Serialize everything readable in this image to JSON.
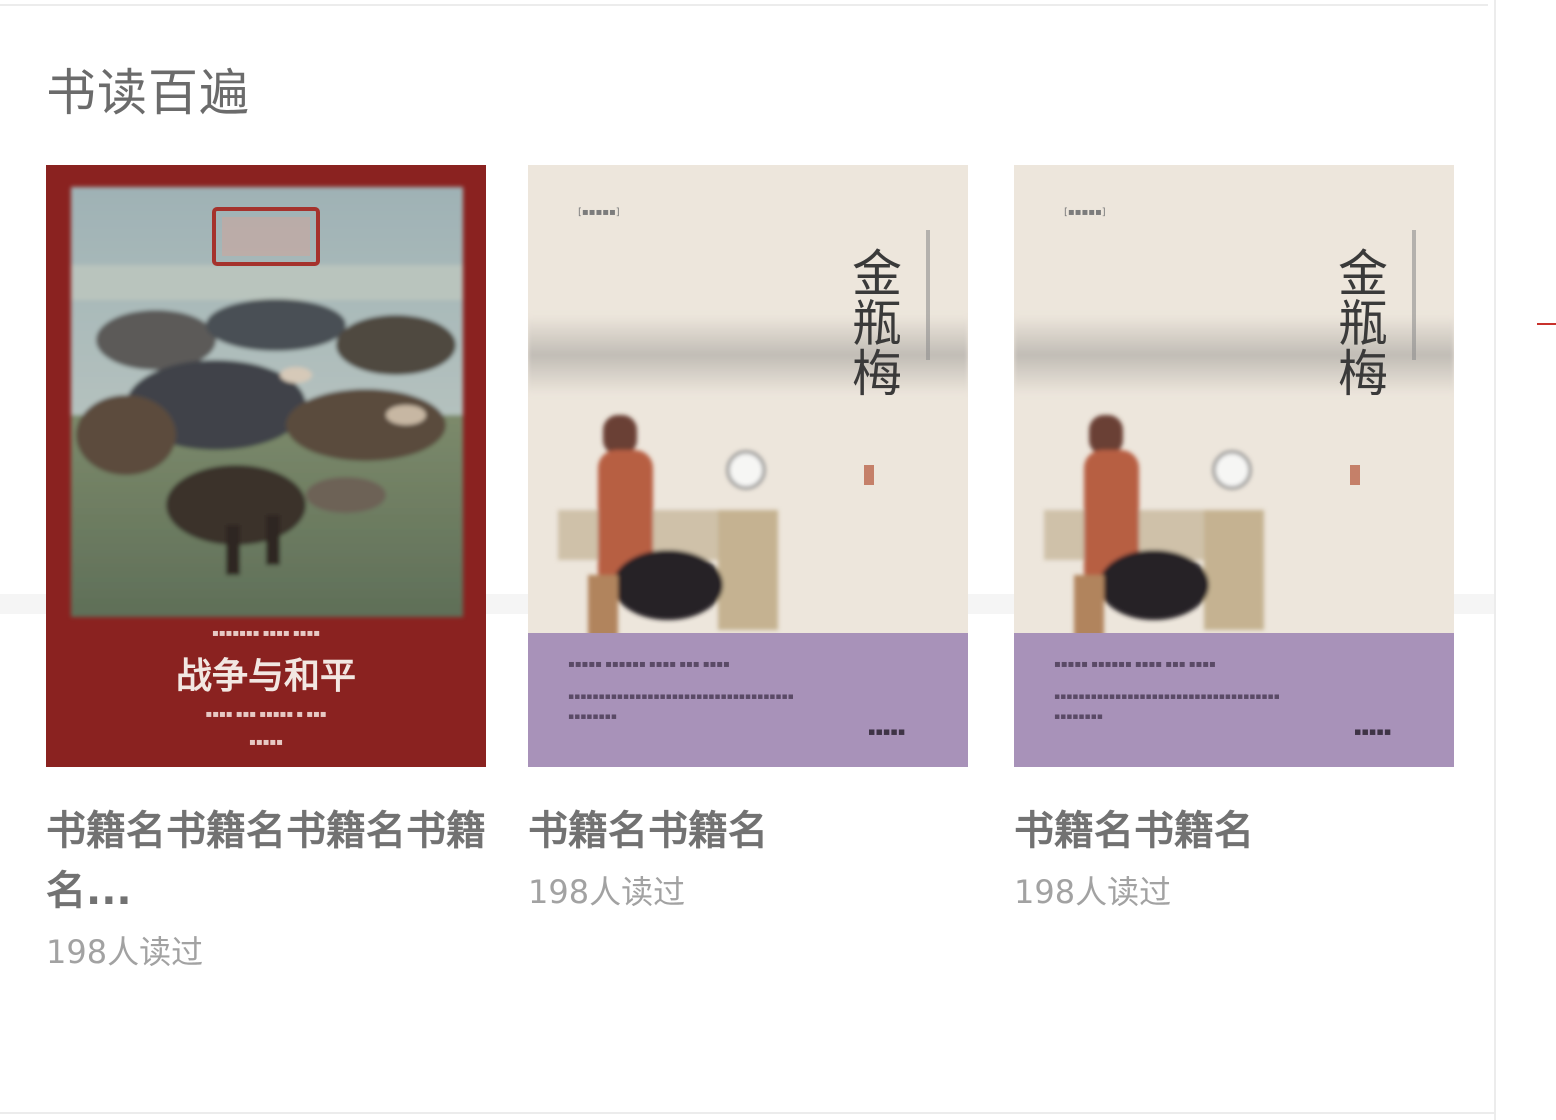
{
  "section": {
    "title": "书读百遍"
  },
  "books": [
    {
      "title": "书籍名书籍名书籍名书籍名...",
      "readers": "198人读过",
      "cover": {
        "title_text": "战争与和平",
        "palette": {
          "frame": "#8a2220",
          "sky": "#9fb2b5",
          "field": "#6f7d61",
          "ink": "#3b3530"
        }
      }
    },
    {
      "title": "书籍名书籍名",
      "readers": "198人读过",
      "cover": {
        "title_text": "金瓶梅",
        "palette": {
          "paper": "#ede6dc",
          "band": "#a892b9",
          "ink": "#3a3a3a",
          "robe": "#b75e43"
        }
      }
    },
    {
      "title": "书籍名书籍名",
      "readers": "198人读过",
      "cover": {
        "title_text": "金瓶梅",
        "palette": {
          "paper": "#ede6dc",
          "band": "#a892b9",
          "ink": "#3a3a3a",
          "robe": "#b75e43"
        }
      }
    }
  ]
}
